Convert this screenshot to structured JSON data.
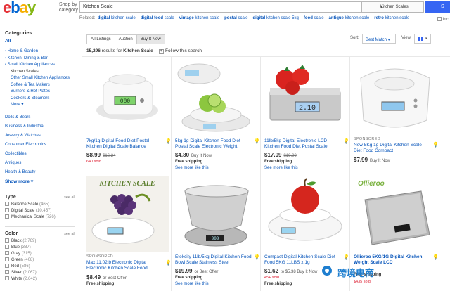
{
  "header": {
    "logo": [
      "e",
      "b",
      "a",
      "y"
    ],
    "shop_by_line1": "Shop by",
    "shop_by_line2": "category",
    "search_value": "Kitchen Scale",
    "category_select": "Kitchen Scales",
    "search_button": "S"
  },
  "related": {
    "label": "Related:",
    "items": [
      {
        "bold": "digital",
        "normal": "kitchen scale"
      },
      {
        "bold": "digital food",
        "normal": "scale"
      },
      {
        "bold": "vintage",
        "normal": "kitchen scale"
      },
      {
        "bold": "postal",
        "normal": "scale"
      },
      {
        "bold": "digital",
        "normal": "kitchen scale 5kg"
      },
      {
        "bold": "food",
        "normal": "scale"
      },
      {
        "bold": "antique",
        "normal": "kitchen scale"
      },
      {
        "bold": "retro",
        "normal": "kitchen scale"
      }
    ],
    "include_label": "inc"
  },
  "sidebar": {
    "title": "Categories",
    "all": "All",
    "links": [
      {
        "label": "‹ Home & Garden",
        "type": "parent"
      },
      {
        "label": "‹ Kitchen, Dining & Bar",
        "type": "parent"
      },
      {
        "label": "‹ Small Kitchen Appliances",
        "type": "parent"
      },
      {
        "label": "Kitchen Scales",
        "type": "current"
      },
      {
        "label": "Other Small Kitchen Appliances",
        "type": "sub"
      },
      {
        "label": "Coffee & Tea Makers",
        "type": "sub"
      },
      {
        "label": "Burners & Hot Plates",
        "type": "sub"
      },
      {
        "label": "Cookers & Steamers",
        "type": "sub"
      },
      {
        "label": "More ▾",
        "type": "sub"
      }
    ],
    "other_cats": [
      "Dolls & Bears",
      "Business & Industrial",
      "Jewelry & Watches",
      "Consumer Electronics",
      "Collectibles",
      "Antiques",
      "Health & Beauty"
    ],
    "show_more": "Show more ▾",
    "type_filter": {
      "title": "Type",
      "see_all": "see all",
      "options": [
        {
          "label": "Balance Scale",
          "count": "(465)"
        },
        {
          "label": "Digital Scale",
          "count": "(10,457)"
        },
        {
          "label": "Mechanical Scale",
          "count": "(726)"
        }
      ]
    },
    "color_filter": {
      "title": "Color",
      "see_all": "see all",
      "options": [
        {
          "label": "Black",
          "count": "(2,769)"
        },
        {
          "label": "Blue",
          "count": "(387)"
        },
        {
          "label": "Gray",
          "count": "(315)"
        },
        {
          "label": "Green",
          "count": "(408)"
        },
        {
          "label": "Red",
          "count": "(586)"
        },
        {
          "label": "Silver",
          "count": "(2,067)"
        },
        {
          "label": "White",
          "count": "(2,642)"
        }
      ]
    }
  },
  "toolbar": {
    "tabs": [
      "All Listings",
      "Auction",
      "Buy It Now"
    ],
    "active_tab": 2,
    "sort_label": "Sort:",
    "sort_value": "Best Match ▾",
    "view_label": "View",
    "results_count": "15,296",
    "results_text": "results for",
    "results_query": "Kitchen Scale",
    "follow_text": "Follow this search"
  },
  "listings": [
    {
      "title": "7kg/1g Digital Food Diet Postal Kitchen Digital Scale Balance",
      "sponsored": "",
      "price": "$8.99",
      "strike": "$16.24",
      "suffix": "",
      "sold": "640 sold",
      "shipping": "",
      "more": ""
    },
    {
      "title": "5kg 1g Digital Kitchen Food Diet Postal Scale Electronic Weight",
      "sponsored": "",
      "price": "$4.80",
      "strike": "",
      "suffix": "Buy It Now",
      "sold": "",
      "shipping": "Free shipping",
      "more": "See more like this"
    },
    {
      "title": "11lb/5kg Digital Electronic LCD Kitchen Food Diet Postal Scale",
      "sponsored": "",
      "price": "$17.09",
      "strike": "$19.99",
      "suffix": "",
      "sold": "",
      "shipping": "Free shipping",
      "more": "See more like this"
    },
    {
      "title": "New 5Kg 1g Digital Kitchen Scale Diet Food Compact",
      "sponsored": "SPONSORED",
      "price": "$7.99",
      "strike": "",
      "suffix": "Buy It Now",
      "sold": "",
      "shipping": "",
      "more": ""
    },
    {
      "title": "Max 11.02lb Electronic Digital Electronic Kitchen Scale Food",
      "sponsored": "SPONSORED",
      "price": "$8.49",
      "strike": "",
      "suffix": "or Best Offer",
      "sold": "",
      "shipping": "Free shipping",
      "more": ""
    },
    {
      "title": "Etekcity 11lb/5kg Digital Kitchen Food Bowl Scale Stainless Steel",
      "sponsored": "",
      "price": "$19.99",
      "strike": "",
      "suffix": "or Best Offer",
      "sold": "",
      "shipping": "Free shipping",
      "more": "See more like this"
    },
    {
      "title": "Compact Digital Kitchen Scale Diet Food 5KG 11LBS x 1g",
      "sponsored": "",
      "price": "$1.62",
      "strike": "",
      "suffix": "to $5.38 Buy It Now",
      "sold": "45+ sold",
      "shipping": "Free shipping",
      "more": ""
    },
    {
      "title": "Ollieroo 5KG/1G Digital Kitchen Weight Scale LCD",
      "sponsored": "",
      "price": "",
      "strike": "",
      "suffix": "",
      "sold": "$435 sold",
      "shipping": "Free shipping",
      "more": ""
    }
  ],
  "image_texts": {
    "kitchen_scale_banner": "KITCHEN SCALE",
    "ollieroo_banner": "Ollieroo",
    "lcd_reading": "2.10"
  },
  "watermark": "跨境电商",
  "colors": {
    "brand_blue": "#0654ba",
    "button_blue": "#3665f3",
    "sold_red": "#dd1e31"
  }
}
